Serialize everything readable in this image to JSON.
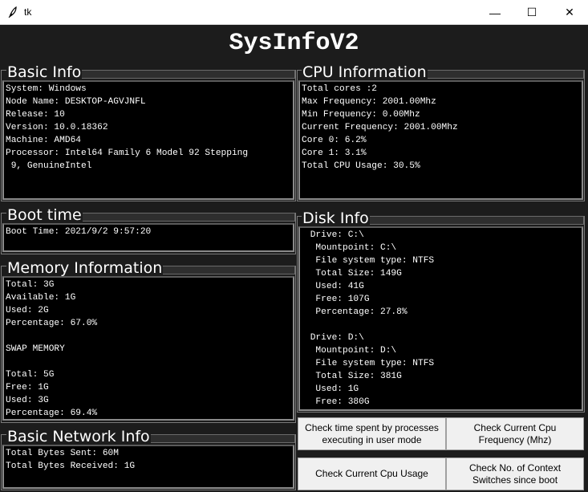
{
  "window": {
    "title": "tk",
    "min_glyph": "—",
    "max_glyph": "☐",
    "close_glyph": "✕"
  },
  "app": {
    "title": "SysInfoV2"
  },
  "basic_info": {
    "label": "Basic Info",
    "lines": [
      "System: Windows",
      "Node Name: DESKTOP-AGVJNFL",
      "Release: 10",
      "Version: 10.0.18362",
      "Machine: AMD64",
      "Processor: Intel64 Family 6 Model 92 Stepping",
      " 9, GenuineIntel"
    ]
  },
  "cpu_info": {
    "label": "CPU Information",
    "lines": [
      "Total cores :2",
      "Max Frequency: 2001.00Mhz",
      "Min Frequency: 0.00Mhz",
      "Current Frequency: 2001.00Mhz",
      "Core 0: 6.2%",
      "Core 1: 3.1%",
      "Total CPU Usage: 30.5%"
    ]
  },
  "boot_time": {
    "label": "Boot time",
    "lines": [
      "Boot Time: 2021/9/2 9:57:20"
    ]
  },
  "disk_info": {
    "label": "Disk Info",
    "lines": [
      " Drive: C:\\",
      "  Mountpoint: C:\\",
      "  File system type: NTFS",
      "  Total Size: 149G",
      "  Used: 41G",
      "  Free: 107G",
      "  Percentage: 27.8%",
      "",
      " Drive: D:\\",
      "  Mountpoint: D:\\",
      "  File system type: NTFS",
      "  Total Size: 381G",
      "  Used: 1G",
      "  Free: 380G"
    ]
  },
  "memory_info": {
    "label": "Memory Information",
    "lines": [
      "Total: 3G",
      "Available: 1G",
      "Used: 2G",
      "Percentage: 67.0%",
      "",
      "SWAP MEMORY",
      "",
      "Total: 5G",
      "Free: 1G",
      "Used: 3G",
      "Percentage: 69.4%"
    ]
  },
  "network_info": {
    "label": "Basic Network Info",
    "lines": [
      "Total Bytes Sent: 60M",
      "Total Bytes Received: 1G"
    ]
  },
  "buttons": {
    "user_mode": "Check time spent by processes executing in user mode",
    "cpu_freq": "Check Current Cpu Frequency (Mhz)",
    "cpu_usage": "Check Current Cpu Usage",
    "ctx_switches": "Check No. of Context Switches since boot"
  }
}
